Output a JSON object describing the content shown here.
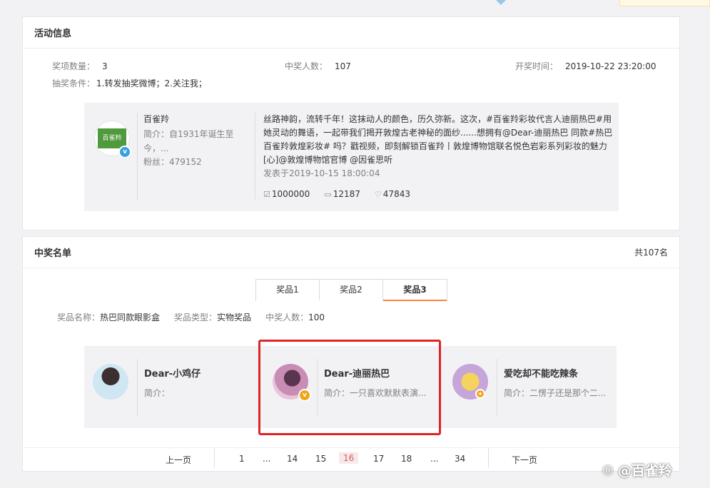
{
  "activity": {
    "title": "活动信息",
    "prize_count_label": "奖项数量：",
    "prize_count": "3",
    "winners_label": "中奖人数：",
    "winners": "107",
    "draw_time_label": "开奖时间：",
    "draw_time": "2019-10-22 23:20:00",
    "conditions_label": "抽奖条件：",
    "conditions": "1.转发抽奖微博；2.关注我；"
  },
  "post": {
    "user_name": "百雀羚",
    "avatar_text": "百雀羚",
    "intro": "简介：自1931年诞生至今，...",
    "fans": "粉丝：479152",
    "text": "丝路神韵，流转千年！这抹动人的颜色，历久弥新。这次，#百雀羚彩妆代言人迪丽热巴#用她灵动的舞语，一起带我们揭开敦煌古老神秘的面纱......想拥有@Dear-迪丽热巴 同款#热巴百雀羚敦煌彩妆# 吗？戳视频，即刻解锁百雀羚丨敦煌博物馆联名悦色岩彩系列彩妆的魅力[心]@敦煌博物馆官博 @因雀思听",
    "time": "发表于2019-10-15 18:00:04",
    "reposts": "1000000",
    "comments": "12187",
    "likes": "47843"
  },
  "winners": {
    "title": "中奖名单",
    "total": "共107名",
    "tabs": [
      "奖品1",
      "奖品2",
      "奖品3"
    ],
    "active_tab": 2,
    "prize_name_label": "奖品名称：",
    "prize_name": "热巴同款眼影盒",
    "prize_type_label": "奖品类型：",
    "prize_type": "实物奖品",
    "prize_winners_label": "中奖人数：",
    "prize_winners": "100",
    "list": [
      {
        "name": "Dear-小鸡仔",
        "intro": "简介："
      },
      {
        "name": "Dear-迪丽热巴",
        "intro": "简介：一只喜欢默默表演..."
      },
      {
        "name": "爱吃却不能吃辣条",
        "intro": "简介：二愣子还是那个二..."
      }
    ]
  },
  "pager": {
    "prev": "上一页",
    "pages": [
      "1",
      "...",
      "14",
      "15",
      "16",
      "17",
      "18",
      "...",
      "34"
    ],
    "current": "16",
    "next": "下一页"
  },
  "watermark": "@百雀羚",
  "colors": {
    "accent": "#ff8140",
    "verified_blue": "#3a9ee0",
    "verified_gold": "#f0a51c",
    "highlight": "#e02424"
  }
}
